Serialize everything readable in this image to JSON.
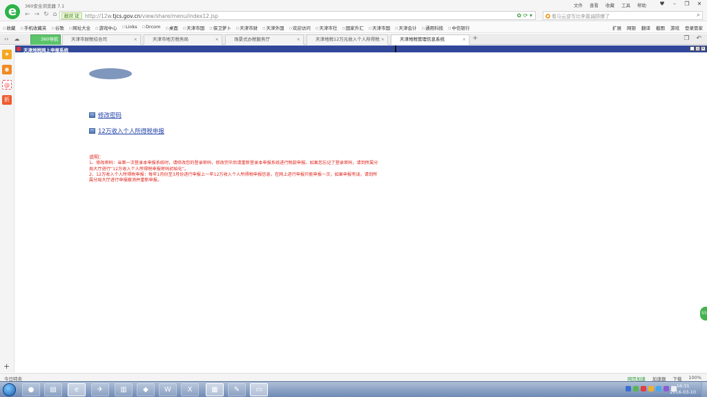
{
  "browser": {
    "app_title": "360安全浏览器 7.1",
    "top_menu": [
      "文件",
      "查看",
      "收藏",
      "工具",
      "帮助"
    ],
    "url_badge": "敌对 证",
    "url_prefix": "http://12w.",
    "url_domain": "tjcs.gov.cn",
    "url_path": "/view/share/menu/index12.jsp",
    "search_placeholder": "看马云逆写比李嘉诚顾爆了",
    "bookmarks": [
      "收藏",
      "手机收藏夹",
      "谷歌",
      "网址大全",
      "游戏中心",
      "Links",
      "Drcom",
      "桌面",
      "天津市国",
      "保卫萝卜",
      "天津市财",
      "天津外国",
      "欢迎访问",
      "天津市社",
      "国家外汇",
      "天津市国",
      "天津会计",
      "通用科技",
      "中信银行"
    ],
    "bookmarks_right": [
      "扩展",
      "网银",
      "翻译",
      "截图",
      "游戏",
      "登录管家"
    ],
    "tabs": [
      {
        "label": "360导航",
        "style": "green"
      },
      {
        "label": "天津市财税综合司",
        "style": "normal"
      },
      {
        "label": "天津市地方税务局",
        "style": "normal"
      },
      {
        "label": "场景式办税服务厅",
        "style": "normal"
      },
      {
        "label": "天津地税12万元收入个人所得税",
        "style": "normal"
      },
      {
        "label": "天津地税管理信息系统",
        "style": "active"
      }
    ]
  },
  "page": {
    "header_title": "天津地税网上申报系统",
    "links": {
      "change_password": "修改密码",
      "income_tax_declare": "12万收入个人所得税申报"
    },
    "notes": {
      "heading": "说明：",
      "line1": "1、修改密码：当第一次登录本申报系统时，请修改您的登录密码，修改完毕后请重新登录本申报系统进行税款申报。如果您忘记了登录密码，请到所属分局大厅进行“12万收入个人所得税申报密码初始化”。",
      "line2": "2、12万收入个人所得税申报：每年1月份至3月份进行申报上一年12万收入个人所得税申报信息，在网上进行申报只能申报一次，如果申报有误，请到所属分局大厅进行申报撤消并重新申报。"
    }
  },
  "statusbar": {
    "left": "今日特卖",
    "right": [
      "网页加速",
      "加速器",
      "下载",
      "100%"
    ]
  },
  "taskbar": {
    "time": "16:31",
    "date": "2016-03-10"
  },
  "float_badge": "55"
}
